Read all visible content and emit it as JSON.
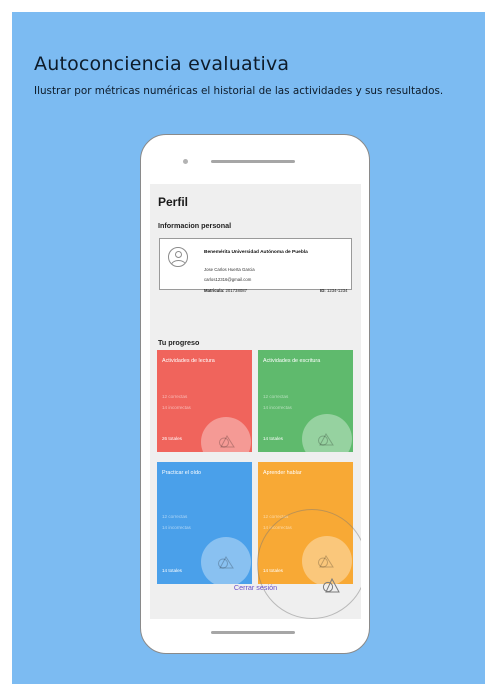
{
  "slide": {
    "title": "Autoconciencia evaluativa",
    "subtitle": "Ilustrar por métricas numéricas el historial de las actividades y sus resultados."
  },
  "screen": {
    "title": "Perfil",
    "personal_section": "Informacion personal",
    "progress_section": "Tu progreso",
    "logout_label": "Cerrar sesión"
  },
  "profile": {
    "university": "Benemérita Universidad Autónoma de Puebla",
    "name": "Jose Carlos Huerta Garcia",
    "email": "carlos12316@gmail.com",
    "matricula_label": "Matricula:",
    "matricula_value": "201738087",
    "id_label": "ID:",
    "id_value": "1234-1234"
  },
  "activities": [
    {
      "title": "Actividades de lectura",
      "correct": "12 correctas",
      "incorrect": "14 incorrectas",
      "total": "26 totales",
      "color": "#f0645c"
    },
    {
      "title": "Actividades de escritura",
      "correct": "12 correctas",
      "incorrect": "14 incorrectas",
      "total": "14 totales",
      "color": "#5fba6d"
    },
    {
      "title": "Practicar el oído",
      "correct": "12 correctas",
      "incorrect": "14 incorrectas",
      "total": "14 totales",
      "color": "#4aa0ea"
    },
    {
      "title": "Aprender hablar",
      "correct": "12 correctas",
      "incorrect": "14 incorrectas",
      "total": "14 totales",
      "color": "#f8a935"
    }
  ],
  "icons": [
    "user-avatar-icon",
    "shapes-icon"
  ],
  "colors": {
    "background": "#7cbbf2",
    "accent": "#6a4fc9"
  }
}
